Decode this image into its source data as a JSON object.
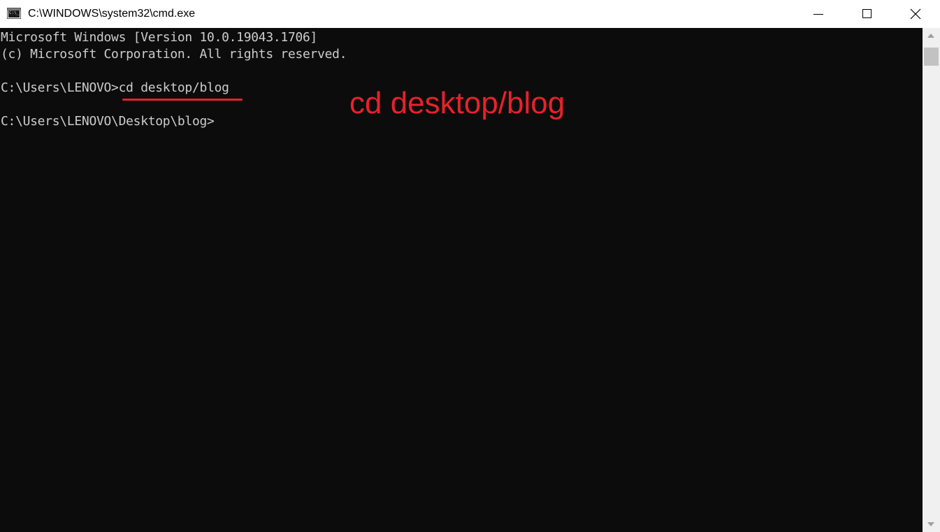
{
  "window": {
    "title": "C:\\WINDOWS\\system32\\cmd.exe",
    "icon": "command-prompt-icon",
    "icon_glyph": "C:\\_",
    "controls": {
      "minimize": "minimize-icon",
      "maximize": "maximize-icon",
      "close": "close-icon"
    }
  },
  "console": {
    "lines": [
      "Microsoft Windows [Version 10.0.19043.1706]",
      "(c) Microsoft Corporation. All rights reserved.",
      "",
      "C:\\Users\\LENOVO>cd desktop/blog",
      "",
      "C:\\Users\\LENOVO\\Desktop\\blog>"
    ]
  },
  "annotation": {
    "text": "cd desktop/blog",
    "color": "#e8212b"
  },
  "colors": {
    "console_background": "#0c0c0c",
    "console_text": "#cccccc",
    "titlebar_background": "#ffffff"
  }
}
